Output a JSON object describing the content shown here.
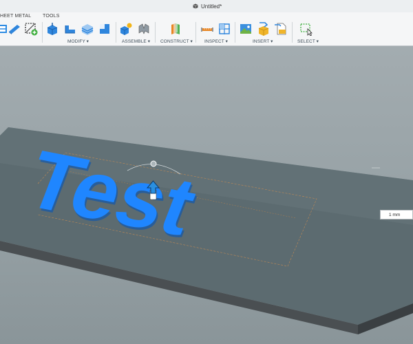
{
  "window": {
    "title": "Untitled*"
  },
  "toolbar": {
    "tabs": [
      "HEET METAL",
      "TOOLS"
    ],
    "groups": [
      "MODIFY ▾",
      "ASSEMBLE ▾",
      "CONSTRUCT ▾",
      "INSPECT ▾",
      "INSERT ▾",
      "SELECT ▾"
    ]
  },
  "viewport": {
    "text_object": "Test",
    "dimension_input": {
      "value": "1 mm"
    }
  },
  "colors": {
    "text_blue": "#1f86ff",
    "plate": "#5a6b70",
    "background": "#9aa4a8",
    "toolbar": "#f5f6f7"
  }
}
